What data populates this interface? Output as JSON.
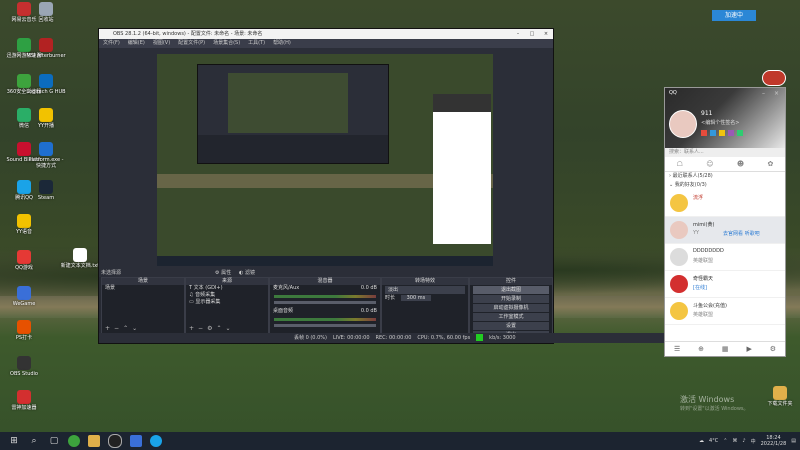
{
  "desktop_icons": [
    {
      "label": "网易云音乐",
      "color": "#c62f2f"
    },
    {
      "label": "回收站",
      "color": "#9aa6b5"
    },
    {
      "label": "迅游网游加速器",
      "color": "#2ea043"
    },
    {
      "label": "MSI Afterburner",
      "color": "#b22222"
    },
    {
      "label": "360安全浏览器",
      "color": "#3da33d"
    },
    {
      "label": "Logitech G HUB",
      "color": "#0b6cbf"
    },
    {
      "label": "微信",
      "color": "#2aae67"
    },
    {
      "label": "YY开播",
      "color": "#f2c200"
    },
    {
      "label": "Sound Blaster",
      "color": "#c8102e"
    },
    {
      "label": "Platform.exe - 快捷方式",
      "color": "#1f6fcf"
    },
    {
      "label": "腾讯QQ",
      "color": "#1aa3e8"
    },
    {
      "label": "Steam",
      "color": "#1b2838"
    },
    {
      "label": "YY语音",
      "color": "#f2c200"
    },
    {
      "label": "QQ游戏",
      "color": "#e53935"
    },
    {
      "label": "新建文本文档.txt",
      "color": "#ffffff"
    },
    {
      "label": "WeGame",
      "color": "#3a6fd8"
    },
    {
      "label": "PS打卡",
      "color": "#e65100"
    },
    {
      "label": "OBS Studio",
      "color": "#333333"
    },
    {
      "label": "雷神加速器",
      "color": "#d32f2f"
    },
    {
      "label": "下载文件夹",
      "color": "#e0b04a"
    }
  ],
  "speed_badge": "加速中",
  "obs": {
    "title": "OBS 28.1.2 (64-bit, windows) - 配置文件: 未命名 - 场景: 未命名",
    "menu": [
      "文件(F)",
      "编辑(E)",
      "视图(V)",
      "配置文件(P)",
      "场景集合(S)",
      "工具(T)",
      "帮助(H)"
    ],
    "no_source_selected": "未选择源",
    "props_label": "属性",
    "filters_label": "滤镜",
    "docks": {
      "scenes": {
        "title": "场景",
        "items": [
          "场景"
        ]
      },
      "sources": {
        "title": "来源",
        "items": [
          "文本 (GDI+)",
          "音频采集",
          "显示器采集"
        ]
      },
      "mixer": {
        "title": "混音器",
        "channels": [
          {
            "name": "麦克风/Aux",
            "db": "0.0 dB"
          },
          {
            "name": "桌面音频",
            "db": "0.0 dB"
          }
        ]
      },
      "transitions": {
        "title": "转场特效",
        "type": "淡出",
        "duration_label": "时长",
        "duration": "300 ms"
      },
      "controls": {
        "title": "控件",
        "buttons": [
          "退出截图",
          "开始录制",
          "启动虚拟摄像机",
          "工作室模式",
          "设置",
          "退出"
        ]
      }
    },
    "status": {
      "dropped": "丢帧 0 (0.0%)",
      "live": "LIVE: 00:00:00",
      "rec": "REC: 00:00:00",
      "cpu": "CPU: 0.7%, 60.00 fps",
      "kbps": "kb/s: 3000"
    }
  },
  "qq": {
    "title": "QQ",
    "nickname": "911",
    "signature": "<编辑个性签名>",
    "search_placeholder": "搜索：联系人...",
    "groups": [
      {
        "label": "最近联系人(5/28)"
      },
      {
        "label": "我的好友(0/3)"
      }
    ],
    "contacts": [
      {
        "name": "流浮",
        "status": "",
        "extra": "",
        "color": "#f4c542"
      },
      {
        "name": "mimi(黄)",
        "status": "YY",
        "extra": "去官网看 听歌吧",
        "color": "#e9c9c0"
      },
      {
        "name": "DDDDDDDD",
        "status": "",
        "extra": "英雄联盟",
        "color": "#f2f2f2"
      },
      {
        "name": "奇怪霸天",
        "status": "",
        "extra": "[在线]",
        "color": "#d32f2f"
      },
      {
        "name": "斗鱼公会(充值)",
        "status": "",
        "extra": "英雄联盟",
        "color": "#f4c542"
      }
    ]
  },
  "watermark": {
    "line1": "激活 Windows",
    "line2": "转到\"设置\"以激活 Windows。"
  },
  "taskbar": {
    "weather": "4°C",
    "time": "18:24",
    "date": "2022/1/28",
    "lang": "中"
  }
}
